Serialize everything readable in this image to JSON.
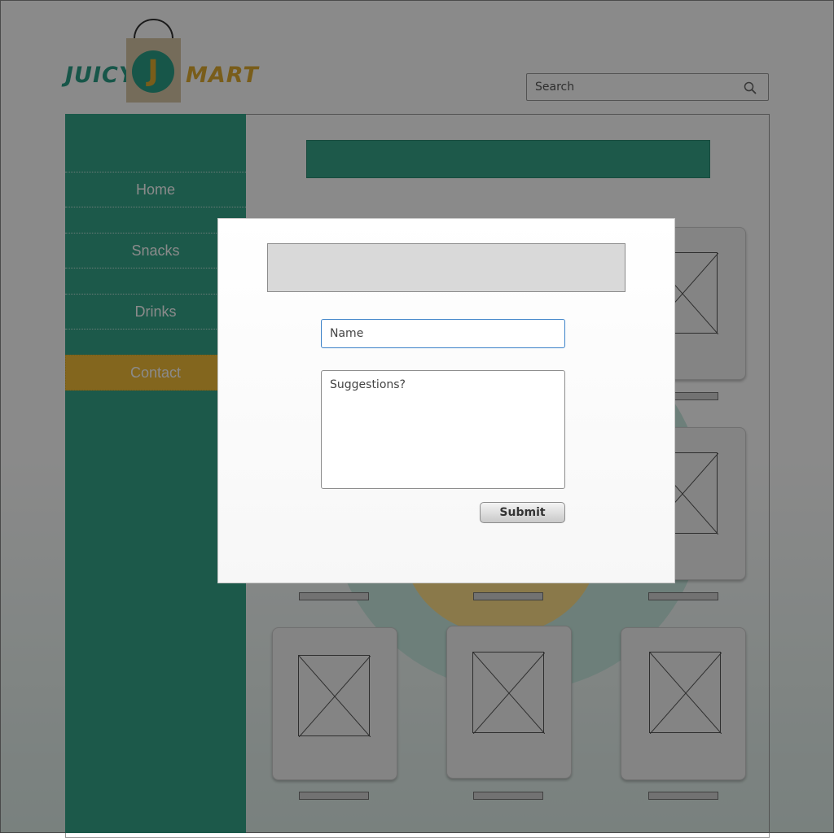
{
  "brand": {
    "word_left": "JUICY",
    "word_right": "MART",
    "monogram": "J"
  },
  "search": {
    "placeholder": "Search",
    "icon": "magnifier-icon"
  },
  "nav": {
    "items": [
      {
        "label": "Home",
        "active": false
      },
      {
        "label": "Snacks",
        "active": false
      },
      {
        "label": "Drinks",
        "active": false
      },
      {
        "label": "Contact",
        "active": true
      }
    ]
  },
  "colors": {
    "teal": "#34a58a",
    "gold": "#f2bd38",
    "overlay": "rgba(0,0,0,0.46)",
    "input_focus": "#3c82c8"
  },
  "modal": {
    "name_placeholder": "Name",
    "suggestions_placeholder": "Suggestions?",
    "submit_label": "Submit"
  }
}
